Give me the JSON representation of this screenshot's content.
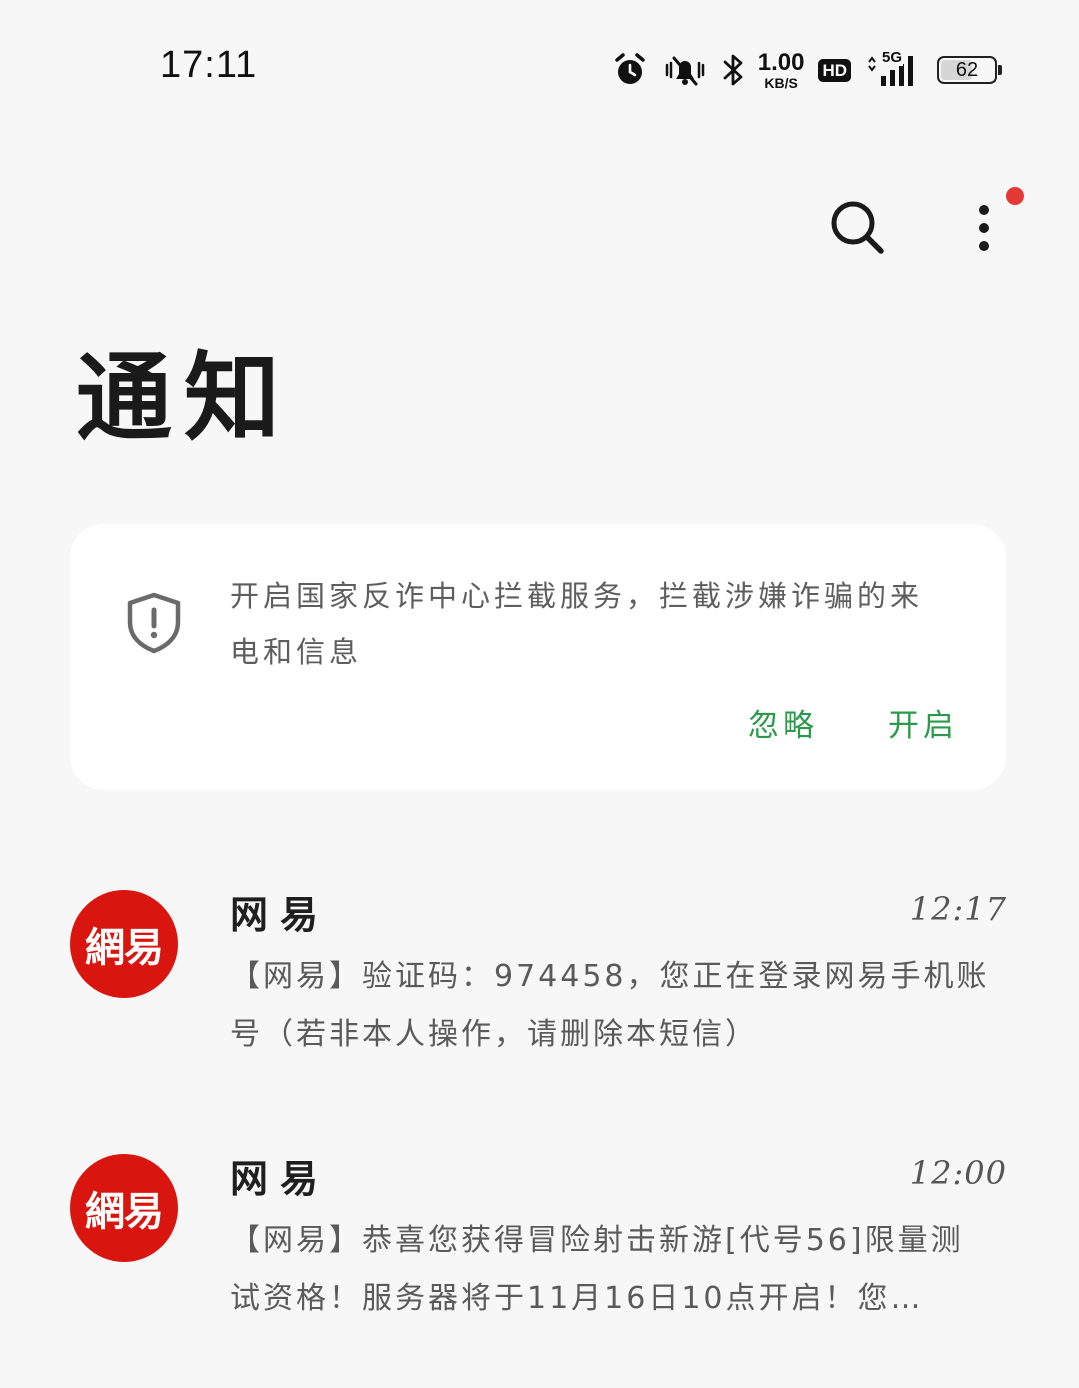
{
  "status_bar": {
    "time": "17:11",
    "net_speed_value": "1.00",
    "net_speed_unit": "KB/S",
    "hd_label": "HD",
    "network_label": "5G",
    "battery_level": "62",
    "battery_fraction": 0.62,
    "icons": [
      "alarm-icon",
      "mute-vibrate-icon",
      "bluetooth-icon",
      "signal-icon",
      "battery-icon"
    ]
  },
  "toolbar": {
    "search_icon": "search-icon",
    "more_icon": "more-vertical-icon",
    "badge_color": "#e53935"
  },
  "page": {
    "title": "通知"
  },
  "fraud_card": {
    "icon": "shield-alert-icon",
    "text": "开启国家反诈中心拦截服务，拦截涉嫌诈骗的来电和信息",
    "ignore_label": "忽略",
    "enable_label": "开启",
    "accent_color": "#2c9a4b"
  },
  "messages": [
    {
      "avatar_text": "網易",
      "sender": "网易",
      "time": "12:17",
      "preview": "【网易】验证码：974458，您正在登录网易手机账号（若非本人操作，请删除本短信）"
    },
    {
      "avatar_text": "網易",
      "sender": "网易",
      "time": "12:00",
      "preview": "【网易】恭喜您获得冒险射击新游[代号56]限量测试资格！服务器将于11月16日10点开启！您…"
    }
  ]
}
